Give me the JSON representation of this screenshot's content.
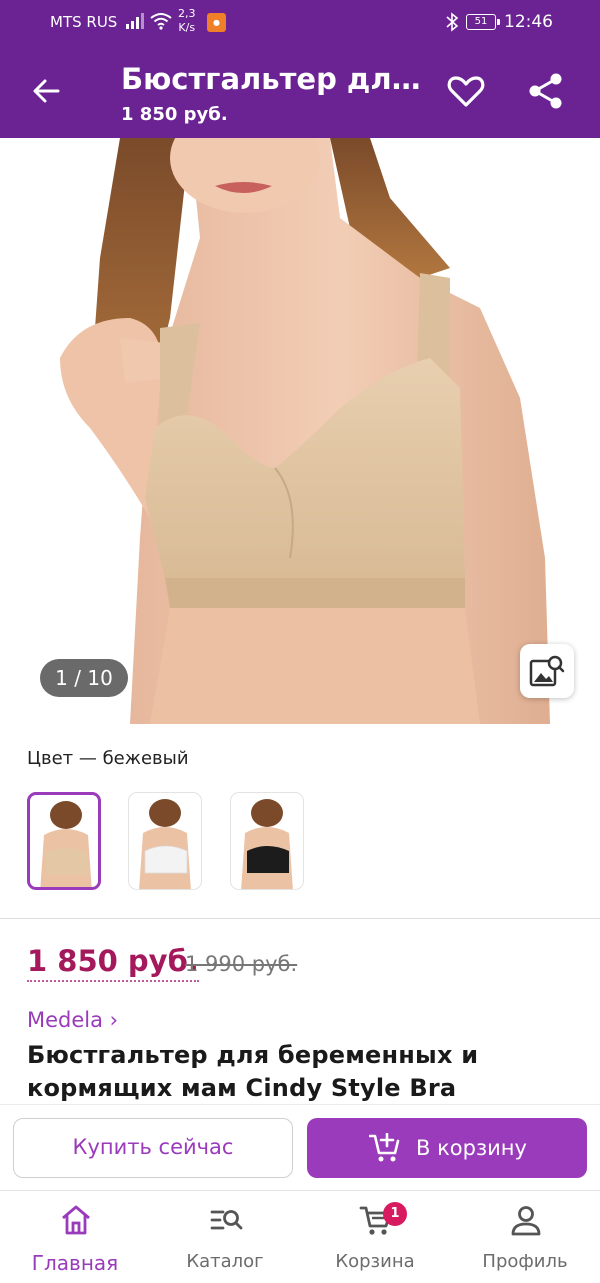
{
  "status_bar": {
    "carrier": "MTS RUS",
    "speed_value": "2,3",
    "speed_unit": "K/s",
    "battery": "51",
    "time": "12:46"
  },
  "header": {
    "title": "Бюстгальтер для...",
    "price": "1 850 руб.",
    "back_icon": "arrow-left-icon",
    "favorite_icon": "heart-outline-icon",
    "share_icon": "share-icon"
  },
  "gallery": {
    "counter": "1 / 10",
    "zoom_icon": "image-search-icon"
  },
  "color": {
    "label": "Цвет — бежевый",
    "swatches": [
      {
        "name": "бежевый",
        "color": "#e4c8a6",
        "selected": true
      },
      {
        "name": "белый",
        "color": "#f3f3f3",
        "selected": false
      },
      {
        "name": "черный",
        "color": "#1c1c1c",
        "selected": false
      }
    ]
  },
  "product": {
    "price": "1 850 руб.",
    "old_price": "1 990 руб.",
    "brand": "Medela ›",
    "name": "Бюстгальтер для беременных и кормящих мам Cindy Style Bra"
  },
  "actions": {
    "buy_now": "Купить сейчас",
    "add_to_cart": "В корзину"
  },
  "bottom_nav": {
    "items": [
      {
        "label": "Главная",
        "icon": "home-icon",
        "active": true
      },
      {
        "label": "Каталог",
        "icon": "catalog-search-icon",
        "active": false
      },
      {
        "label": "Корзина",
        "icon": "cart-icon",
        "active": false,
        "badge": "1"
      },
      {
        "label": "Профиль",
        "icon": "profile-icon",
        "active": false
      }
    ]
  },
  "colors": {
    "brand_purple": "#6b2393",
    "accent_purple": "#9a3bbb",
    "price_red": "#a3195b",
    "badge_red": "#d81b60"
  }
}
